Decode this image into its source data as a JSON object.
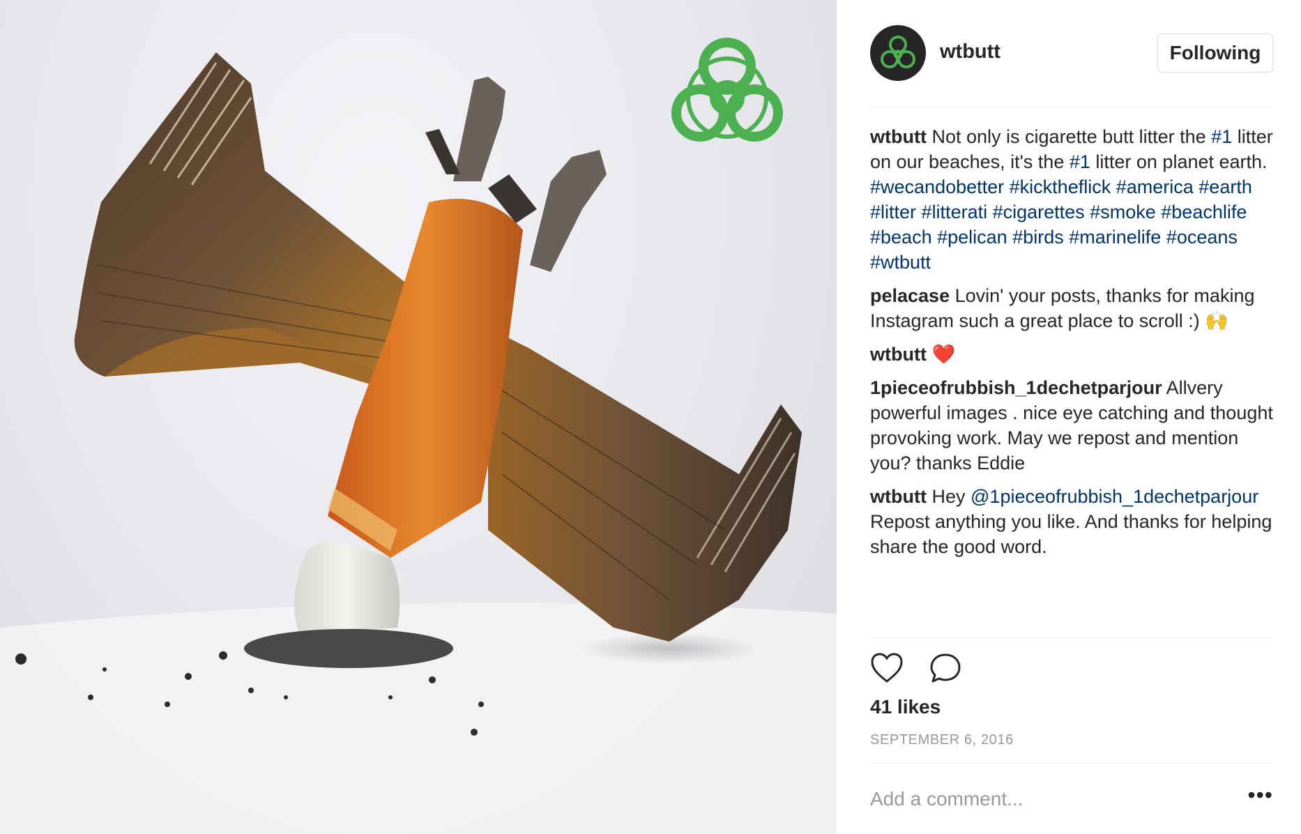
{
  "post": {
    "image_alt": "",
    "author": {
      "username": "wtbutt",
      "follow_label": "Following",
      "avatar_icon": "biohazard-icon"
    },
    "comments": [
      {
        "user": "wtbutt",
        "parts": [
          {
            "t": "text",
            "v": "Not only is cigarette butt litter the "
          },
          {
            "t": "tag",
            "v": "#1"
          },
          {
            "t": "text",
            "v": " litter on our beaches, it's the "
          },
          {
            "t": "tag",
            "v": "#1"
          },
          {
            "t": "text",
            "v": " litter on planet earth. "
          },
          {
            "t": "tag",
            "v": "#wecandobetter"
          },
          {
            "t": "text",
            "v": " "
          },
          {
            "t": "tag",
            "v": "#kicktheflick"
          },
          {
            "t": "text",
            "v": " "
          },
          {
            "t": "tag",
            "v": "#america"
          },
          {
            "t": "text",
            "v": " "
          },
          {
            "t": "tag",
            "v": "#earth"
          },
          {
            "t": "text",
            "v": " "
          },
          {
            "t": "tag",
            "v": "#litter"
          },
          {
            "t": "text",
            "v": " "
          },
          {
            "t": "tag",
            "v": "#litterati"
          },
          {
            "t": "text",
            "v": " "
          },
          {
            "t": "tag",
            "v": "#cigarettes"
          },
          {
            "t": "text",
            "v": " "
          },
          {
            "t": "tag",
            "v": "#smoke"
          },
          {
            "t": "text",
            "v": " "
          },
          {
            "t": "tag",
            "v": "#beachlife"
          },
          {
            "t": "text",
            "v": " "
          },
          {
            "t": "tag",
            "v": "#beach"
          },
          {
            "t": "text",
            "v": " "
          },
          {
            "t": "tag",
            "v": "#pelican"
          },
          {
            "t": "text",
            "v": " "
          },
          {
            "t": "tag",
            "v": "#birds"
          },
          {
            "t": "text",
            "v": " "
          },
          {
            "t": "tag",
            "v": "#marinelife"
          },
          {
            "t": "text",
            "v": " "
          },
          {
            "t": "tag",
            "v": "#oceans"
          },
          {
            "t": "text",
            "v": " "
          },
          {
            "t": "tag",
            "v": "#wtbutt"
          }
        ]
      },
      {
        "user": "pelacase",
        "parts": [
          {
            "t": "text",
            "v": "Lovin' your posts, thanks for making Instagram such a great place to scroll :) 🙌"
          }
        ]
      },
      {
        "user": "wtbutt",
        "parts": [
          {
            "t": "text",
            "v": "❤️"
          }
        ]
      },
      {
        "user": "1pieceofrubbish_1dechetparjour",
        "parts": [
          {
            "t": "text",
            "v": "Allvery powerful images . nice eye catching and thought provoking work. May we repost and mention you? thanks Eddie"
          }
        ]
      },
      {
        "user": "wtbutt",
        "parts": [
          {
            "t": "text",
            "v": "Hey "
          },
          {
            "t": "mention",
            "v": "@1pieceofrubbish_1dechetparjour"
          },
          {
            "t": "text",
            "v": " Repost anything you like. And thanks for helping share the good word."
          }
        ]
      }
    ],
    "actions": {
      "like_icon": "heart-icon",
      "comment_icon": "comment-bubble-icon"
    },
    "likes": "41 likes",
    "date": "SEPTEMBER 6, 2016",
    "add_comment_placeholder": "Add a comment...",
    "more_label": "•••",
    "colors": {
      "link": "#003569",
      "text": "#262626",
      "muted": "#999999",
      "border": "#dbdbdb",
      "biohazard_green": "#4caf50"
    }
  }
}
